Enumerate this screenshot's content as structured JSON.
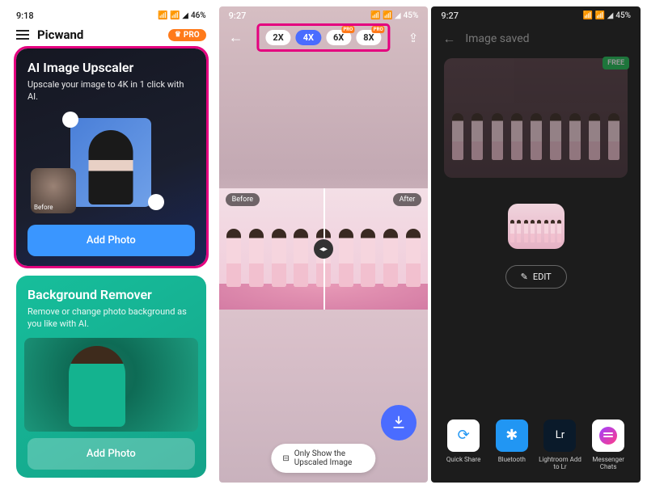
{
  "p1": {
    "time": "9:18",
    "battery": "46%",
    "brand": "Picwand",
    "pro": "PRO",
    "card1": {
      "title": "AI Image Upscaler",
      "desc": "Upscale your image to 4K in 1 click with AI.",
      "before": "Before",
      "cta": "Add Photo"
    },
    "card2": {
      "title": "Background Remover",
      "desc": "Remove or change photo background as you like with AI.",
      "cta": "Add Photo"
    }
  },
  "p2": {
    "time": "9:27",
    "battery": "45%",
    "zoom": [
      "2X",
      "4X",
      "6X",
      "8X"
    ],
    "zoom_pro": "PRO",
    "before": "Before",
    "after": "After",
    "toggle": "Only Show the Upscaled Image"
  },
  "p3": {
    "time": "9:27",
    "battery": "45%",
    "title": "Image saved",
    "free": "FREE",
    "edit": "EDIT",
    "share": [
      {
        "label": "Quick Share",
        "cls": "ic-qs",
        "glyph": "⟳"
      },
      {
        "label": "Bluetooth",
        "cls": "ic-bt",
        "glyph": "✱"
      },
      {
        "label": "Lightroom Add to Lr",
        "cls": "ic-lr",
        "glyph": "Lr"
      },
      {
        "label": "Messenger Chats",
        "cls": "ic-msg",
        "glyph": ""
      }
    ]
  }
}
